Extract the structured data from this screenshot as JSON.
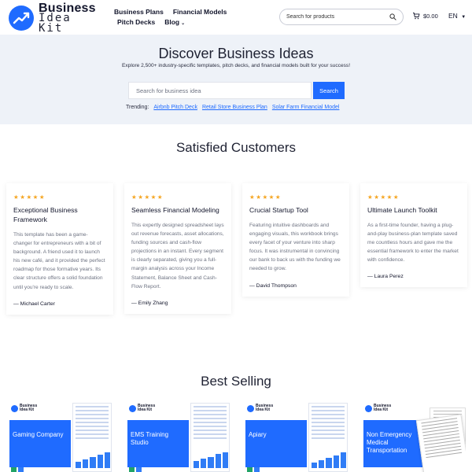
{
  "header": {
    "logo": {
      "line1": "Business",
      "line2": "Idea Kit"
    },
    "nav": [
      {
        "label": "Business Plans"
      },
      {
        "label": "Financial Models"
      },
      {
        "label": "Pitch Decks"
      },
      {
        "label": "Blog"
      }
    ],
    "search": {
      "placeholder": "Search for products"
    },
    "cart_total": "$0.00",
    "language": "EN"
  },
  "hero": {
    "title": "Discover Business Ideas",
    "subtitle": "Explore 2,500+ industry-specific templates, pitch decks, and financial models built for your success!",
    "search_placeholder": "Search for business idea",
    "search_button": "Search",
    "trending_label": "Trending:",
    "trending_links": [
      "Airbnb Pitch Deck",
      "Retail Store Business Plan",
      "Solar Farm Financial Model"
    ]
  },
  "testimonials": {
    "title": "Satisfied Customers",
    "stars": "★★★★★",
    "items": [
      {
        "title": "Exceptional Business Framework",
        "text": "This template has been a game-changer for entrepreneurs with a bit of background. A friend used it to launch his new café, and it provided the perfect roadmap for those formative years. Its clear structure offers a solid foundation until you're ready to scale.",
        "author": "— Michael Carter"
      },
      {
        "title": "Seamless Financial Modeling",
        "text": "This expertly designed spreadsheet lays out revenue forecasts, asset allocations, funding sources and cash-flow projections in an instant. Every segment is clearly separated, giving you a full-margin analysis across your Income Statement, Balance Sheet and Cash-Flow Report.",
        "author": "— Emily Zhang"
      },
      {
        "title": "Crucial Startup Tool",
        "text": "Featuring intuitive dashboards and engaging visuals, this workbook brings every facet of your venture into sharp focus. It was instrumental in convincing our bank to back us with the funding we needed to grow.",
        "author": "— David Thompson"
      },
      {
        "title": "Ultimate Launch Toolkit",
        "text": "As a first-time founder, having a plug-and-play business-plan template saved me countless hours and gave me the essential framework to enter the market with confidence.",
        "author": "— Laura Perez"
      }
    ]
  },
  "best_selling": {
    "title": "Best Selling",
    "products": [
      {
        "name": "Gaming Company"
      },
      {
        "name": "EMS Training Studio"
      },
      {
        "name": "Apiary"
      },
      {
        "name": "Non Emergency Medical Transportation"
      }
    ]
  },
  "colors": {
    "accent": "#1f6bff",
    "hero_bg": "#eef2f8",
    "star": "#f5a623"
  }
}
